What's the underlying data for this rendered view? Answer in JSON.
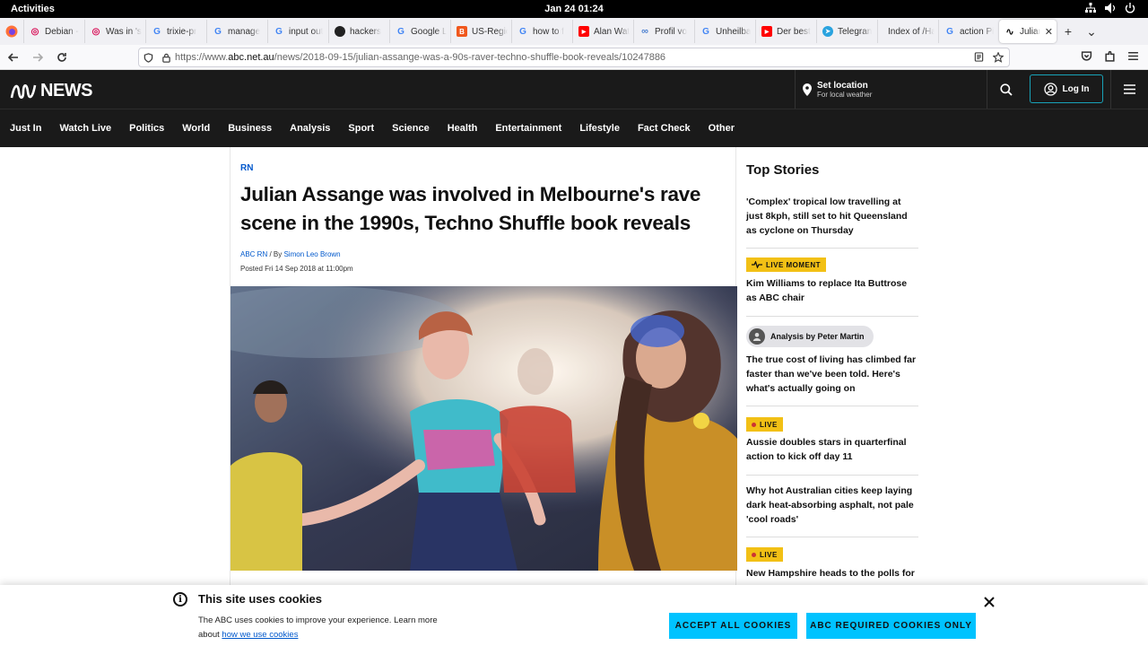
{
  "system": {
    "activities": "Activities",
    "clock": "Jan 24  01:24"
  },
  "browser": {
    "tabs": [
      {
        "title": "Debian -",
        "favicon": "debian-swirl",
        "color": "#d70751"
      },
      {
        "title": "Was in 's",
        "favicon": "debian-swirl",
        "color": "#d70751"
      },
      {
        "title": "trixie-pr",
        "favicon": "google-g",
        "color": "#4285f4"
      },
      {
        "title": "manage",
        "favicon": "google-g",
        "color": "#4285f4"
      },
      {
        "title": "input out",
        "favicon": "google-g",
        "color": "#4285f4"
      },
      {
        "title": "hackers",
        "favicon": "github-octocat",
        "color": "#222222"
      },
      {
        "title": "Google L",
        "favicon": "google-lens",
        "color": "#4285f4"
      },
      {
        "title": "US-Regic",
        "favicon": "blogger-b",
        "color": "#f0571c"
      },
      {
        "title": "how to f",
        "favicon": "google-g",
        "color": "#4285f4"
      },
      {
        "title": "Alan Wat",
        "favicon": "youtube",
        "color": "#ff0000"
      },
      {
        "title": "Profil vo",
        "favicon": "link-chain",
        "color": "#4a7fd0"
      },
      {
        "title": "Unheilba",
        "favicon": "google-g",
        "color": "#4285f4"
      },
      {
        "title": "Der best",
        "favicon": "youtube",
        "color": "#ff0000"
      },
      {
        "title": "Telegran",
        "favicon": "telegram",
        "color": "#2aa3df"
      },
      {
        "title": "Index of /Ha",
        "favicon": "none",
        "color": "#ffffff"
      },
      {
        "title": "action Pi",
        "favicon": "google-g",
        "color": "#4285f4"
      },
      {
        "title": "Julian",
        "favicon": "abc-mark",
        "color": "#111111",
        "active": true
      }
    ],
    "url_prefix": "https://www.",
    "url_host": "abc.net.au",
    "url_path": "/news/2018-09-15/julian-assange-was-a-90s-raver-techno-shuffle-book-reveals/10247886"
  },
  "abc": {
    "logo_mark": "ꟾꟾꟾ",
    "logo_text": "NEWS",
    "set_location": "Set location",
    "set_location_sub": "For local weather",
    "login": "Log In",
    "menu": [
      "Just In",
      "Watch Live",
      "Politics",
      "World",
      "Business",
      "Analysis",
      "Sport",
      "Science",
      "Health",
      "Entertainment",
      "Lifestyle",
      "Fact Check",
      "Other"
    ]
  },
  "article": {
    "kicker": "RN",
    "headline": "Julian Assange was involved in Melbourne's rave scene in the 1990s, Techno Shuffle book reveals",
    "byline_source": "ABC RN",
    "byline_by": " / By ",
    "byline_author": "Simon Leo Brown",
    "posted": "Posted Fri 14 Sep 2018 at 11:00pm"
  },
  "top_stories": {
    "heading": "Top Stories",
    "items": [
      {
        "title": "'Complex' tropical low travelling at just 8kph, still set to hit Queensland as cyclone on Thursday"
      },
      {
        "badge": "LIVE MOMENT",
        "title": "Kim Williams to replace Ita Buttrose as ABC chair"
      },
      {
        "badge": "Analysis by Peter Martin",
        "title": "The true cost of living has climbed far faster than we've been told. Here's what's actually going on"
      },
      {
        "badge": "LIVE",
        "title": "Aussie doubles stars in quarterfinal action to kick off day 11"
      },
      {
        "title": "Why hot Australian cities keep laying dark heat-absorbing asphalt, not pale 'cool roads'"
      },
      {
        "badge": "LIVE",
        "title": "New Hampshire heads to the polls for"
      }
    ]
  },
  "cookie_banner": {
    "title": "This site uses cookies",
    "body": "The ABC uses cookies to improve your experience. Learn more about ",
    "link": "how we use cookies",
    "accept_all": "ACCEPT ALL COOKIES",
    "required_only": "ABC REQUIRED COOKIES ONLY"
  },
  "colors": {
    "abc_dark": "#1a1a1a",
    "link_blue": "#0058cc",
    "live_yellow": "#f2c015",
    "cookie_cyan": "#00c3ff",
    "login_border": "#18a2b8"
  }
}
